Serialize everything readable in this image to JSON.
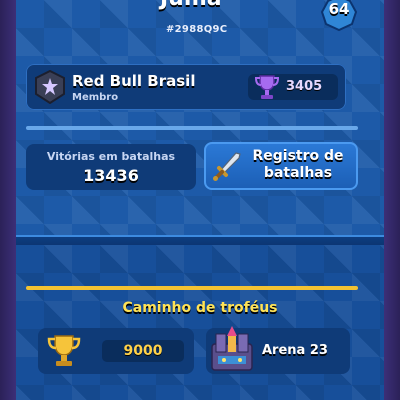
{
  "profile": {
    "player_name": "Juma",
    "level": "64",
    "player_tag": "#2988Q9C"
  },
  "clan": {
    "name": "Red Bull Brasil",
    "role": "Membro",
    "trophies": "3405"
  },
  "stats": {
    "wins_label": "Vitórias em batalhas",
    "wins_value": "13436"
  },
  "battle_log": {
    "label": "Registro de batalhas"
  },
  "trophy_road": {
    "title": "Caminho de troféus",
    "trophies": "9000",
    "arena": "Arena 23"
  },
  "colors": {
    "panel_blue": "#1d5aa8",
    "gold": "#f3c232",
    "purple_trophy": "#9b5de5"
  },
  "icons": [
    "level-badge-icon",
    "clan-badge-icon",
    "purple-trophy-icon",
    "sword-icon",
    "gold-trophy-icon",
    "arena-icon"
  ]
}
